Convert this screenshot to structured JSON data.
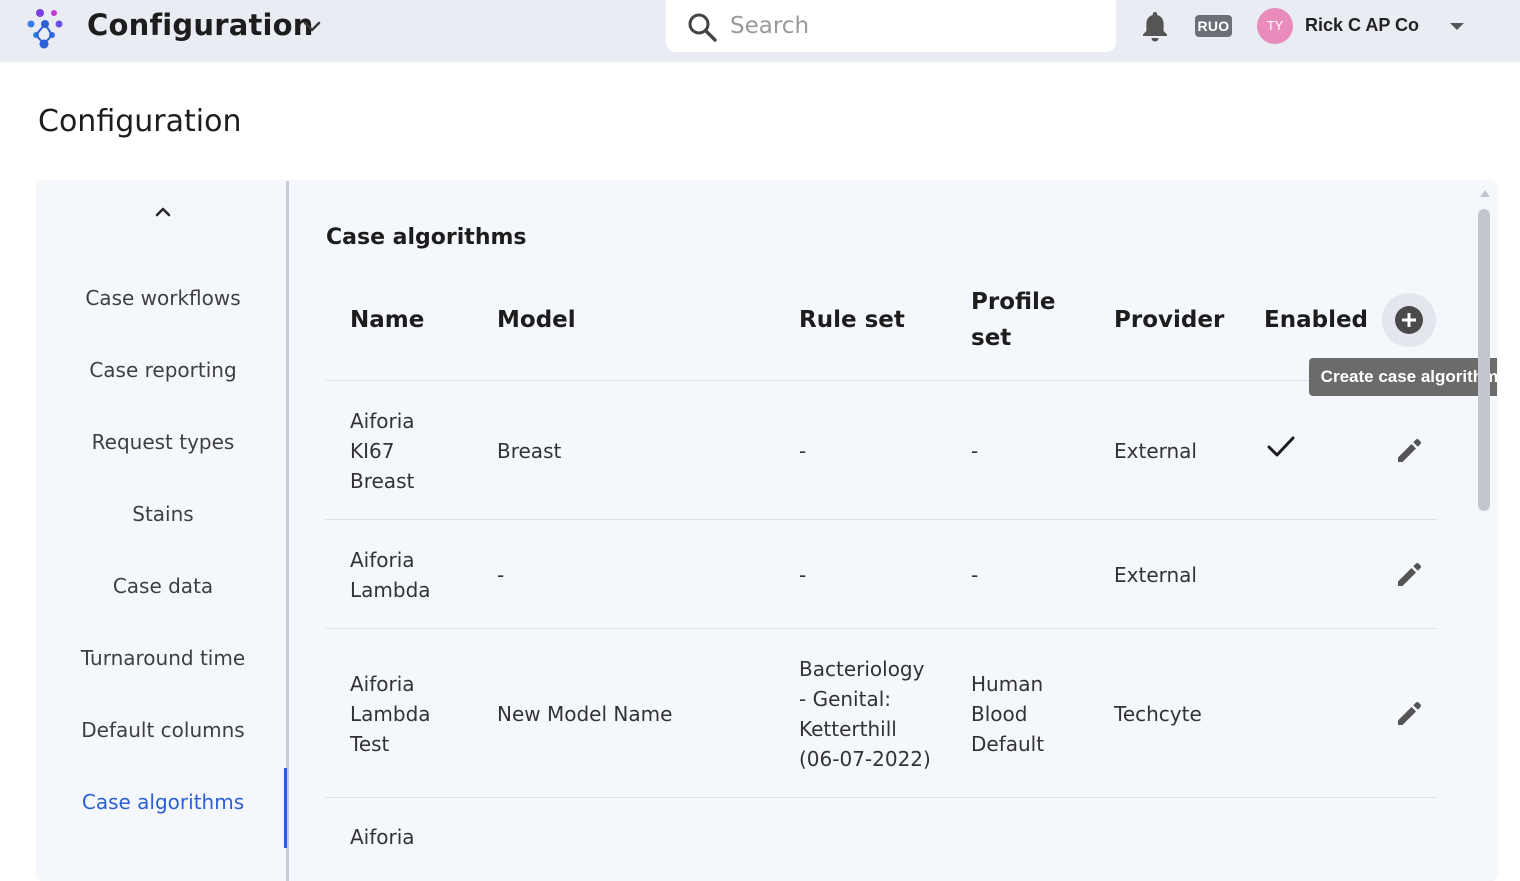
{
  "header": {
    "app_title": "Configuration",
    "search_placeholder": "Search",
    "ruo_badge": "RUO",
    "avatar_initials": "TY",
    "user_name": "Rick C AP Co",
    "avatar_color": "#e98bbb"
  },
  "page": {
    "title": "Configuration"
  },
  "sidebar": {
    "items": [
      {
        "label": "Case workflows"
      },
      {
        "label": "Case reporting"
      },
      {
        "label": "Request types"
      },
      {
        "label": "Stains"
      },
      {
        "label": "Case data"
      },
      {
        "label": "Turnaround time"
      },
      {
        "label": "Default columns"
      },
      {
        "label": "Case algorithms",
        "active": true
      }
    ],
    "accent_color": "#2c5fd6"
  },
  "main": {
    "section_title": "Case algorithms",
    "columns": {
      "name": "Name",
      "model": "Model",
      "rule_set": "Rule set",
      "profile_set_line1": "Profile",
      "profile_set_line2": "set",
      "provider": "Provider",
      "enabled": "Enabled"
    },
    "add_tooltip": "Create case algorithm",
    "rows": [
      {
        "name": [
          "Aiforia",
          "KI67",
          "Breast"
        ],
        "model": "Breast",
        "rule_set": [
          "-"
        ],
        "profile_set": [
          "-"
        ],
        "provider": "External",
        "enabled": true
      },
      {
        "name": [
          "Aiforia",
          "Lambda"
        ],
        "model": "-",
        "rule_set": [
          "-"
        ],
        "profile_set": [
          "-"
        ],
        "provider": "External",
        "enabled": false
      },
      {
        "name": [
          "Aiforia",
          "Lambda",
          "Test"
        ],
        "model": "New Model Name",
        "rule_set": [
          "Bacteriology",
          "- Genital:",
          "Ketterthill",
          "(06-07-2022)"
        ],
        "profile_set": [
          "Human",
          "Blood",
          "Default"
        ],
        "provider": "Techcyte",
        "enabled": false
      },
      {
        "name": [
          "Aiforia"
        ]
      }
    ]
  }
}
